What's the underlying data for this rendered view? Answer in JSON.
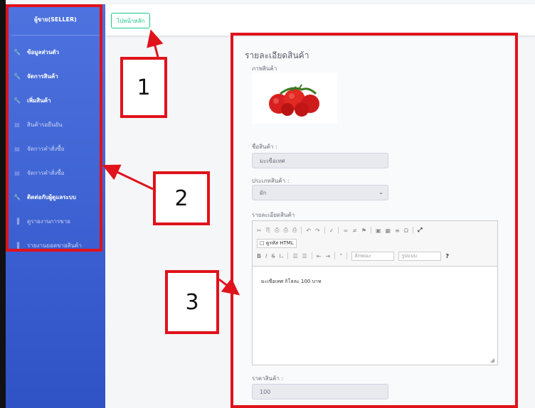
{
  "sidebar": {
    "brand": "ผู้ขาย(SELLER)",
    "items": [
      {
        "label": "ข้อมูลส่วนตัว",
        "icon": "wrench-icon"
      },
      {
        "label": "จัดการสินค้า",
        "icon": "wrench-icon"
      },
      {
        "label": "เพิ่มสินค้า",
        "icon": "wrench-icon"
      },
      {
        "label": "สินค้ารอยืนยัน",
        "icon": "table-icon"
      },
      {
        "label": "จัดการคำสั่งซื้อ",
        "icon": "table-icon"
      },
      {
        "label": "จัดการคำสั่งซื้อ",
        "icon": "table-icon"
      },
      {
        "label": "ติดต่อกับผู้ดูแลระบบ",
        "icon": "wrench-icon"
      },
      {
        "label": "ดูรายงานการขาย",
        "icon": "chart-icon"
      },
      {
        "label": "รายงานยอดขายสินค้า",
        "icon": "chart-icon"
      }
    ]
  },
  "topbar": {
    "home_button": "ไปหน้าหลัก"
  },
  "product": {
    "title": "รายละเอียดสินค้า",
    "image_label": "ภาพสินค้า",
    "name_label": "ชื่อสินค้า :",
    "name_value": "มะเขือเทศ",
    "type_label": "ประเภทสินค้า :",
    "type_value": "ผัก",
    "desc_label": "รายละเอียดสินค้า",
    "desc_value": "มะเขือเทศ กิโลละ 100 บาท",
    "price_label": "ราคาสินค้า :",
    "price_value": "100"
  },
  "editor": {
    "source_label": "ดูรหัส HTML",
    "format_dropdown": "ลักษณะ",
    "style_dropdown": "รูปแบบ",
    "help": "?"
  },
  "annotations": {
    "one": "1",
    "two": "2",
    "three": "3"
  },
  "colors": {
    "sidebar": "#4e73df",
    "accent_green": "#1cc88a",
    "annotation_red": "#e0121b"
  }
}
